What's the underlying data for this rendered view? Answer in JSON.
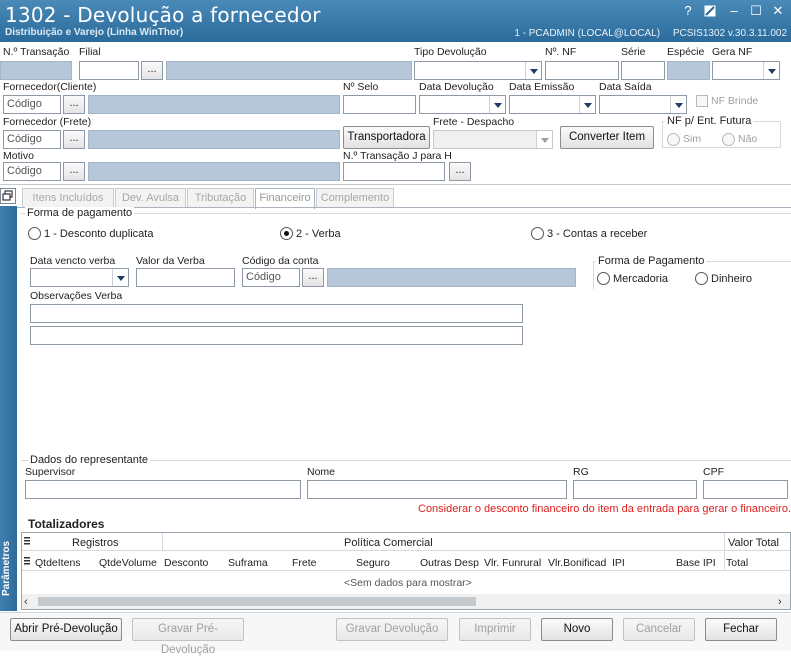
{
  "window": {
    "title": "1302 - Devolução a fornecedor",
    "subtitle": "Distribuição e Varejo (Linha WinThor)",
    "session": "1 - PCADMIN (LOCAL@LOCAL)",
    "version": "PCSIS1302  v.30.3.11.002",
    "help_glyph": "?",
    "minimize_glyph": "–",
    "maximize_glyph": "☐",
    "close_glyph": "✕"
  },
  "header": {
    "transacao_label": "N.º Transação",
    "filial_label": "Filial",
    "tipo_devolucao_label": "Tipo Devolução",
    "nf_label": "Nº. NF",
    "serie_label": "Série",
    "especie_label": "Espécie",
    "gera_nf_label": "Gera NF",
    "fornecedor_cliente_label": "Fornecedor(Cliente)",
    "codigo_placeholder": "Código",
    "selo_label": "Nº Selo",
    "data_devolucao_label": "Data Devolução",
    "data_emissao_label": "Data Emissão",
    "data_saida_label": "Data Saída",
    "nf_brinde_label": "NF Brinde",
    "fornecedor_frete_label": "Fornecedor (Frete)",
    "transportadora_button": "Transportadora",
    "frete_despacho_label": "Frete - Despacho",
    "converter_item_button": "Converter Item",
    "nf_ent_futura_label": "NF p/ Ent. Futura",
    "sim_label": "Sim",
    "nao_label": "Não",
    "motivo_label": "Motivo",
    "transacao_j_label": "N.º Transação J para H",
    "ellipsis": "..."
  },
  "tabs": [
    {
      "label": "Itens Incluídos"
    },
    {
      "label": "Dev. Avulsa"
    },
    {
      "label": "Tributação"
    },
    {
      "label": "Financeiro"
    },
    {
      "label": "Complemento"
    }
  ],
  "financeiro": {
    "forma_pagamento_title": "Forma de pagamento",
    "opt1": "1 - Desconto duplicata",
    "opt2": "2 - Verba",
    "opt3": "3 - Contas a receber",
    "selected_option": 2,
    "data_vencto_label": "Data vencto verba",
    "valor_verba_label": "Valor da Verba",
    "codigo_conta_label": "Código da conta",
    "codigo_placeholder": "Código",
    "forma_pgto2_title": "Forma de Pagamento",
    "mercadoria_label": "Mercadoria",
    "dinheiro_label": "Dinheiro",
    "observacoes_label": "Observações Verba"
  },
  "representante": {
    "title": "Dados do representante",
    "supervisor_label": "Supervisor",
    "nome_label": "Nome",
    "rg_label": "RG",
    "cpf_label": "CPF"
  },
  "notice": "Considerar o desconto financeiro do item da entrada para gerar o financeiro.",
  "totalizadores": {
    "title": "Totalizadores",
    "side_panel_label": "Parâmetros",
    "band_registros": "Registros",
    "band_politica": "Política Comercial",
    "band_valor_total": "Valor Total",
    "columns": [
      "QtdeItens",
      "QtdeVolume",
      "Desconto",
      "Suframa",
      "Frete",
      "Seguro",
      "Outras Desp",
      "Vlr. Funrural",
      "Vlr.Bonificad",
      "IPI",
      "Base IPI",
      "Total"
    ],
    "empty_text": "<Sem dados para mostrar>"
  },
  "footer": {
    "abrir": "Abrir Pré-Devolução",
    "gravar_pre": "Gravar Pré-Devolução",
    "gravar_dev": "Gravar Devolução",
    "imprimir": "Imprimir",
    "novo": "Novo",
    "cancelar": "Cancelar",
    "fechar": "Fechar"
  },
  "colors": {
    "title_bar": "#2b6b9b",
    "readonly_field": "#b5c7d9",
    "notice_text": "#e01e1e"
  }
}
